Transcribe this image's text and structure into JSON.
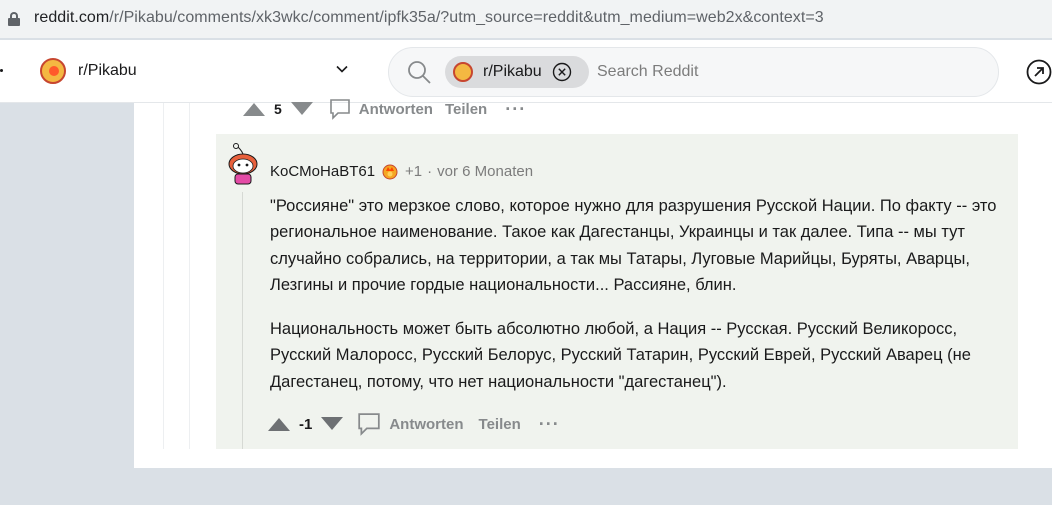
{
  "browser": {
    "url_host": "reddit.com",
    "url_path": "/r/Pikabu/comments/xk3wkc/comment/ipfk35a/?utm_source=reddit&utm_medium=web2x&context=3"
  },
  "header": {
    "subreddit_name": "r/Pikabu",
    "search_chip_label": "r/Pikabu",
    "search_placeholder": "Search Reddit"
  },
  "parent_actions": {
    "vote_count": "5",
    "reply_label": "Antworten",
    "share_label": "Teilen",
    "more_label": "···"
  },
  "comment": {
    "author": "KoCMoHaBT61",
    "karma": "+1",
    "separator": "·",
    "time": "vor 6 Monaten",
    "paragraphs": [
      "\"Россияне\" это мерзкое слово, которое нужно для разрушения Русской Нации. По факту -- это региональное наименование. Такое как Дагестанцы, Украинцы и так далее. Типа -- мы тут случайно собрались, на территории, а так мы Татары, Луговые Марийцы, Буряты, Аварцы, Лезгины и прочие гордые национальности... Рассияне, блин.",
      "Национальность может быть абсолютно любой, а Нация -- Русская. Русский Великоросс, Русский Малоросс, Русский Белорус, Русский Татарин, Русский Еврей, Русский Аварец (не Дагестанец, потому, что нет национальности \"дагестанец\")."
    ],
    "vote_count": "-1",
    "reply_label": "Antworten",
    "share_label": "Teilen",
    "more_label": "···"
  },
  "colors": {
    "page_bg": "#dae0e6",
    "reply_highlight": "#f0f3ee",
    "muted_text": "#878a8c",
    "body_text": "#1a1a1b"
  }
}
